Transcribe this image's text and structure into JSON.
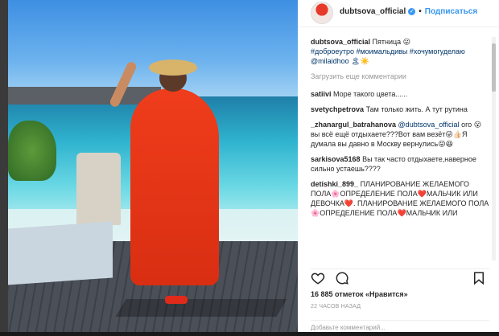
{
  "post": {
    "photo_alt": "",
    "header": {
      "username": "dubtsova_official",
      "separator": "•",
      "follow_label": "Подписаться"
    },
    "caption": {
      "username": "dubtsova_official",
      "text": "Пятница 😛",
      "hashtags": "#доброеутро #моимальдивы #хочумогуделаю @milaidhoo 🏝☀️"
    },
    "load_more": "Загрузить еще комментарии",
    "comments": [
      {
        "user": "satiivi",
        "text": "Море такого цвета......"
      },
      {
        "user": "svetychpetrova",
        "text": "Там только жить. А тут рутина"
      },
      {
        "user": "_zhanargul_batrahanova",
        "mention": "@dubtsova_official",
        "text": "ого 😮 вы всё ещё отдыхаете???Вот вам везёт😜👍🏻Я думала вы давно в Москву вернулись😜😆"
      },
      {
        "user": "sarkisova5168",
        "text": "Вы так часто отдыхаете,наверное сильно устаешь????"
      },
      {
        "user": "detishki_899_",
        "text": "ПЛАНИРОВАНИЕ ЖЕЛАЕМОГО ПОЛА🌸ОПРЕДЕЛЕНИЕ ПОЛА❤️МАЛЬЧИК ИЛИ ДЕВОЧКА❤️. ПЛАНИРОВАНИЕ ЖЕЛАЕМОГО ПОЛА🌸ОПРЕДЕЛЕНИЕ ПОЛА❤️МАЛЬЧИК ИЛИ"
      }
    ],
    "likes": "16 885 отметок «Нравится»",
    "time": "22 ЧАСОВ НАЗАД",
    "add_comment_placeholder": "Добавьте комментарий..."
  },
  "colors": {
    "accent": "#3897f0",
    "dress": "#e63a1f"
  },
  "icons": {
    "like": "heart-icon",
    "comment": "comment-icon",
    "save": "bookmark-icon",
    "verified": "verified-badge-icon"
  }
}
